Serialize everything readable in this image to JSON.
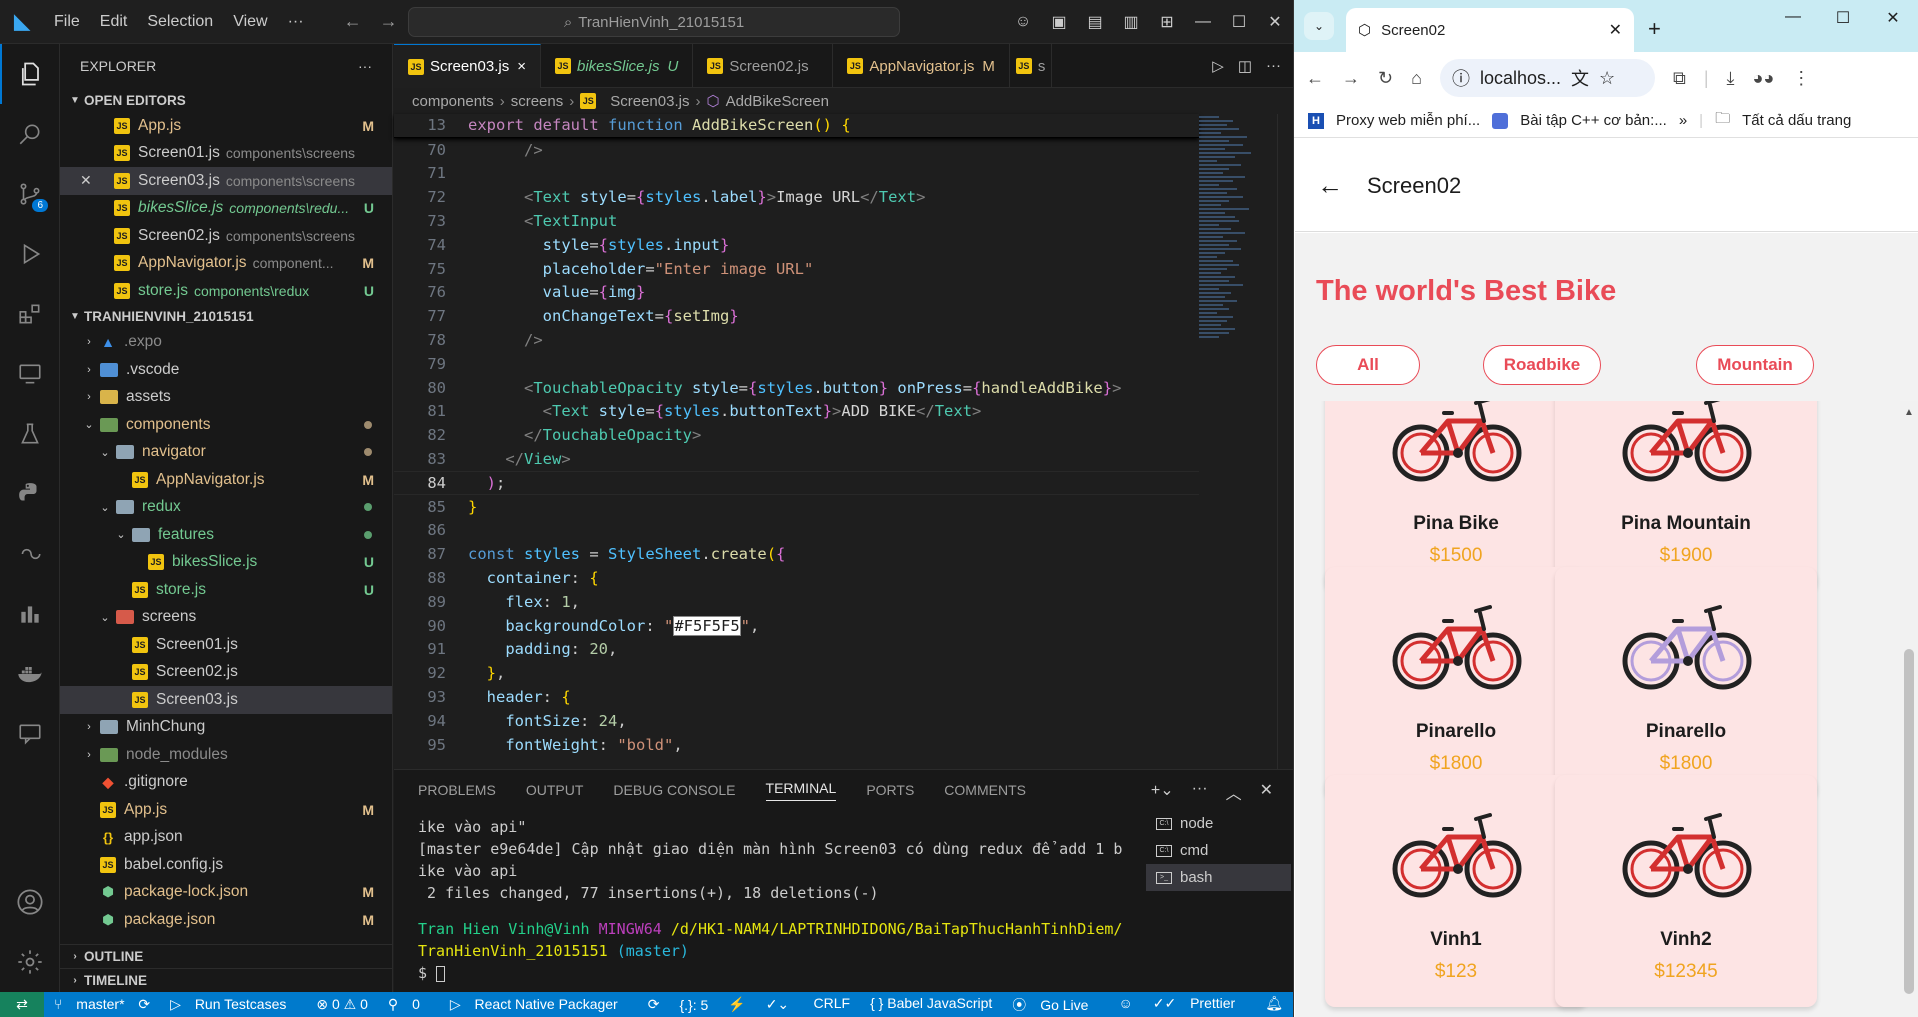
{
  "vscode": {
    "menu": [
      "File",
      "Edit",
      "Selection",
      "View",
      "···"
    ],
    "search_text": "TranHienVinh_21015151",
    "explorer_title": "EXPLORER",
    "open_editors_label": "OPEN EDITORS",
    "open_editors": [
      {
        "name": "App.js",
        "path": "",
        "status": "M"
      },
      {
        "name": "Screen01.js",
        "path": "components\\screens",
        "status": ""
      },
      {
        "name": "Screen03.js",
        "path": "components\\screens",
        "status": ""
      },
      {
        "name": "bikesSlice.js",
        "path": "components\\redu...",
        "status": "U"
      },
      {
        "name": "Screen02.js",
        "path": "components\\screens",
        "status": ""
      },
      {
        "name": "AppNavigator.js",
        "path": "component...",
        "status": "M"
      },
      {
        "name": "store.js",
        "path": "components\\redux",
        "status": "U"
      }
    ],
    "project_label": "TRANHIENVINH_21015151",
    "tree": [
      {
        "name": ".expo",
        "status": ""
      },
      {
        "name": ".vscode",
        "status": ""
      },
      {
        "name": "assets",
        "status": ""
      },
      {
        "name": "components",
        "status": "•"
      },
      {
        "name": "navigator",
        "status": "•"
      },
      {
        "name": "AppNavigator.js",
        "status": "M"
      },
      {
        "name": "redux",
        "status": "•"
      },
      {
        "name": "features",
        "status": "•"
      },
      {
        "name": "bikesSlice.js",
        "status": "U"
      },
      {
        "name": "store.js",
        "status": "U"
      },
      {
        "name": "screens",
        "status": ""
      },
      {
        "name": "Screen01.js",
        "status": ""
      },
      {
        "name": "Screen02.js",
        "status": ""
      },
      {
        "name": "Screen03.js",
        "status": ""
      },
      {
        "name": "MinhChung",
        "status": ""
      },
      {
        "name": "node_modules",
        "status": ""
      },
      {
        "name": ".gitignore",
        "status": ""
      },
      {
        "name": "App.js",
        "status": "M"
      },
      {
        "name": "app.json",
        "status": ""
      },
      {
        "name": "babel.config.js",
        "status": ""
      },
      {
        "name": "package-lock.json",
        "status": "M"
      },
      {
        "name": "package.json",
        "status": "M"
      }
    ],
    "outline_label": "OUTLINE",
    "timeline_label": "TIMELINE",
    "tabs": [
      {
        "name": "Screen03.js",
        "status": "×"
      },
      {
        "name": "bikesSlice.js",
        "status": "U"
      },
      {
        "name": "Screen02.js",
        "status": ""
      },
      {
        "name": "AppNavigator.js",
        "status": "M"
      },
      {
        "name": "s",
        "status": ""
      }
    ],
    "breadcrumb": [
      "components",
      "screens",
      "Screen03.js",
      "AddBikeScreen"
    ],
    "line_numbers": [
      "13",
      "70",
      "71",
      "72",
      "73",
      "74",
      "75",
      "76",
      "77",
      "78",
      "79",
      "80",
      "81",
      "82",
      "83",
      "84",
      "85",
      "86",
      "87",
      "88",
      "89",
      "90",
      "91",
      "92",
      "93",
      "94",
      "95"
    ],
    "panel_tabs": [
      "PROBLEMS",
      "OUTPUT",
      "DEBUG CONSOLE",
      "TERMINAL",
      "PORTS",
      "COMMENTS"
    ],
    "terminal_lines": [
      "ike vào api\"",
      "[master e9e64de] Cập nhật giao diện màn hình Screen03 có dùng redux để add 1 b",
      "ike vào api",
      " 2 files changed, 77 insertions(+), 18 deletions(-)",
      ""
    ],
    "prompt_user": "Tran Hien Vinh@Vinh",
    "prompt_host": "MINGW64",
    "prompt_path": "/d/HK1-NAM4/LAPTRINHDIDONG/BaiTapThucHanhTinhDiem/",
    "prompt_path2": "TranHienVinh_21015151",
    "prompt_branch": "(master)",
    "prompt_symbol": "$",
    "terminals": [
      "node",
      "cmd",
      "bash"
    ],
    "status": {
      "branch": "master*",
      "run_tests": "Run Testcases",
      "errors": "⊗ 0 ⚠ 0",
      "ports": "0",
      "packager": "React Native Packager",
      "sel": "{.}: 5",
      "crlf": "CRLF",
      "lang": "{ } Babel JavaScript",
      "golive": "Go Live",
      "prettier": "Prettier"
    },
    "scm_badge": "6"
  },
  "chrome": {
    "tab_title": "Screen02",
    "url": "localhos...",
    "bookmarks": [
      "Proxy web miễn phí...",
      "Bài tập C++ cơ bản:...",
      "Tất cả dấu trang"
    ],
    "bookmark_more": "»"
  },
  "app": {
    "header_title": "Screen02",
    "title": "The world's Best Bike",
    "filters": [
      "All",
      "Roadbike",
      "Mountain"
    ],
    "products": [
      {
        "name": "Pina Bike",
        "price": "$1500",
        "bike_color": "#d32f2f"
      },
      {
        "name": "Pina Mountain",
        "price": "$1900",
        "bike_color": "#d32f2f"
      },
      {
        "name": "Pinarello",
        "price": "$1800",
        "bike_color": "#d32f2f"
      },
      {
        "name": "Pinarello",
        "price": "$1800",
        "bike_color": "#b39ddb"
      },
      {
        "name": "Vinh1",
        "price": "$123",
        "bike_color": "#d32f2f"
      },
      {
        "name": "Vinh2",
        "price": "$12345",
        "bike_color": "#d32f2f"
      }
    ],
    "accent": "#e94b57",
    "price_color": "#f0a420",
    "card_bg": "#fde4e4"
  }
}
